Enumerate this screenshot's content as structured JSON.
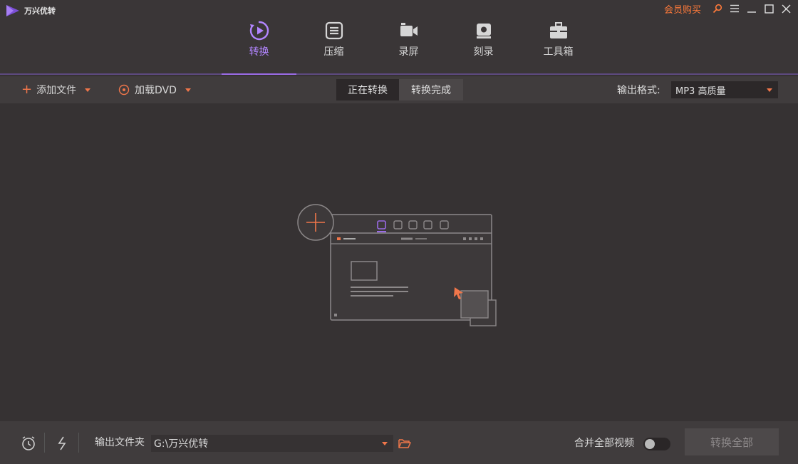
{
  "app": {
    "name": "万兴优转",
    "vip_label": "会员购买"
  },
  "colors": {
    "accent": "#9a6be6",
    "orange": "#f0764a",
    "vip": "#ff7a3a"
  },
  "nav": [
    {
      "label": "转换",
      "icon": "play-circle-icon",
      "active": true
    },
    {
      "label": "压缩",
      "icon": "compress-icon",
      "active": false
    },
    {
      "label": "录屏",
      "icon": "video-camera-icon",
      "active": false
    },
    {
      "label": "刻录",
      "icon": "disc-icon",
      "active": false
    },
    {
      "label": "工具箱",
      "icon": "toolbox-icon",
      "active": false
    }
  ],
  "toolbar": {
    "add_file": "添加文件",
    "load_dvd": "加载DVD",
    "tab_converting": "正在转换",
    "tab_done": "转换完成",
    "output_format_label": "输出格式:",
    "output_format_value": "MP3 高质量"
  },
  "bottom": {
    "output_folder_label": "输出文件夹",
    "output_path": "G:\\万兴优转",
    "merge_label": "合并全部视频",
    "convert_all": "转换全部"
  }
}
